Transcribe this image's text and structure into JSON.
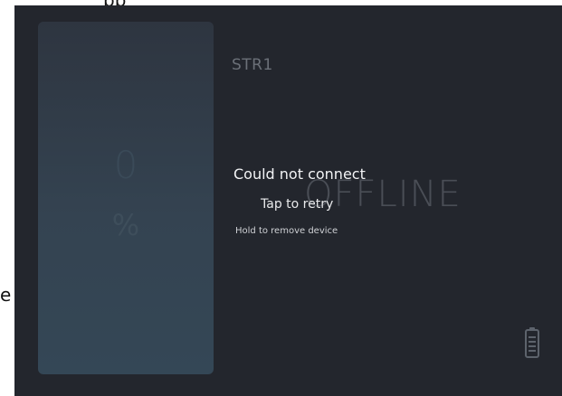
{
  "app": {
    "top_fragment": "pp",
    "left_fragment": "e"
  },
  "device": {
    "name": "STR1",
    "level_value": "0",
    "level_unit": "%",
    "level_fraction": 0,
    "status": "OFFLINE",
    "error_title": "Could not connect",
    "retry_label": "Tap to retry",
    "remove_label": "Hold to remove device",
    "battery_icon": "battery-icon"
  },
  "colors": {
    "panel_bg": "#23262d",
    "card_bg": "#344351",
    "muted_text": "#6b7078",
    "status_text": "#4a4e56",
    "primary_text": "#f2f3f5"
  }
}
